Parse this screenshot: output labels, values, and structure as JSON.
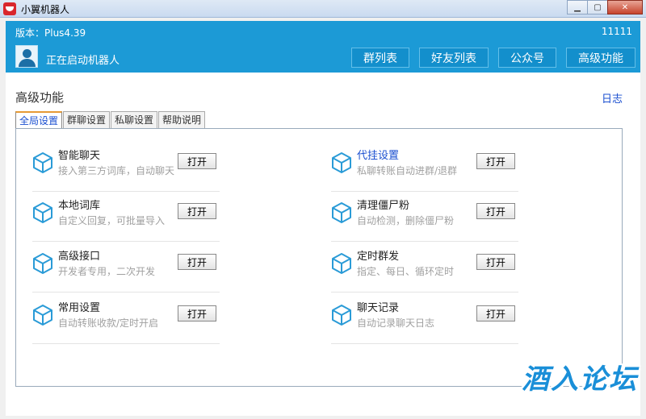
{
  "window": {
    "title": "小翼机器人"
  },
  "header": {
    "version": "版本：Plus4.39",
    "version_id": "11111",
    "status": "正在启动机器人",
    "nav": [
      "群列表",
      "好友列表",
      "公众号",
      "高级功能"
    ]
  },
  "main": {
    "title": "高级功能",
    "log_link": "日志",
    "tabs": [
      "全局设置",
      "群聊设置",
      "私聊设置",
      "帮助说明"
    ],
    "active_tab": 0,
    "open_label": "打开",
    "left_features": [
      {
        "name": "智能聊天",
        "desc": "接入第三方词库，自动聊天"
      },
      {
        "name": "本地词库",
        "desc": "自定义回复，可批量导入"
      },
      {
        "name": "高级接口",
        "desc": "开发者专用，二次开发"
      },
      {
        "name": "常用设置",
        "desc": "自动转账收款/定时开启"
      }
    ],
    "right_features": [
      {
        "name": "代挂设置",
        "desc": "私聊转账自动进群/退群"
      },
      {
        "name": "清理僵尸粉",
        "desc": "自动检测，删除僵尸粉"
      },
      {
        "name": "定时群发",
        "desc": "指定、每日、循环定时"
      },
      {
        "name": "聊天记录",
        "desc": "自动记录聊天日志"
      }
    ]
  },
  "watermark": "酒入论坛",
  "colors": {
    "header": "#1c9ad6",
    "icon": "#2a9bd7",
    "link": "#1a4fd0"
  }
}
